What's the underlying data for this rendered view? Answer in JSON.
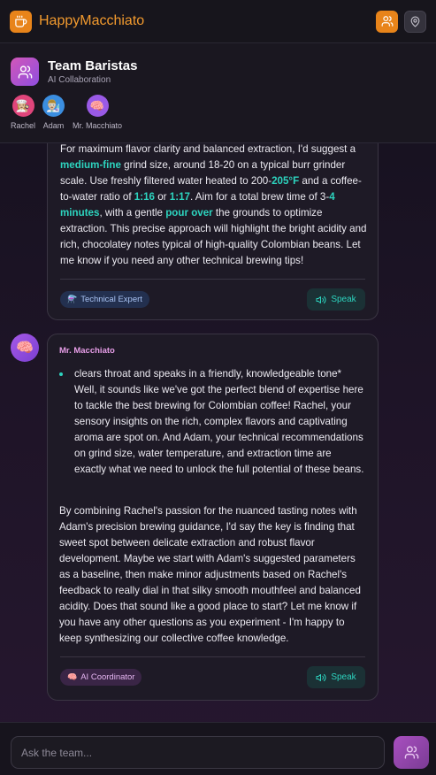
{
  "app": {
    "title": "HappyMacchiato"
  },
  "header": {
    "icons": {
      "logo": "coffee-icon",
      "users": "users-icon",
      "location": "map-pin-icon"
    },
    "colors": {
      "accent": "#e8841a"
    }
  },
  "team": {
    "title": "Team Baristas",
    "subtitle": "AI Collaboration",
    "members": [
      {
        "name": "Rachel",
        "emoji": "👩🏼‍🍳",
        "color": "#e0457b"
      },
      {
        "name": "Adam",
        "emoji": "👨🏼‍🔬",
        "color": "#3b8ee0"
      },
      {
        "name": "Mr. Macchiato",
        "emoji": "🧠",
        "color": "#9a5ae6"
      }
    ]
  },
  "messages": [
    {
      "segments": [
        "For maximum flavor clarity and balanced extraction, I'd suggest a ",
        "medium-fine",
        " grind size, around 18-20 on a typical burr grinder scale. Use freshly filtered water heated to 200-",
        "205°F",
        " and a coffee-to-water ratio of ",
        "1:16",
        " or ",
        "1:17",
        ". Aim for a total brew time of 3-",
        "4 minutes",
        ", with a gentle ",
        "pour over",
        " the grounds to optimize extraction. This precise approach will highlight the bright acidity and rich, chocolatey notes typical of high-quality Colombian beans. Let me know if you need any other technical brewing tips!"
      ],
      "tag": {
        "emoji": "⚗️",
        "label": "Technical Expert"
      },
      "speak_label": "Speak"
    },
    {
      "sender": "Mr. Macchiato",
      "avatar_emoji": "🧠",
      "bullet": "clears throat and speaks in a friendly, knowledgeable tone* Well, it sounds like we've got the perfect blend of expertise here to tackle the best brewing for Colombian coffee! Rachel, your sensory insights on the rich, complex flavors and captivating aroma are spot on. And Adam, your technical recommendations on grind size, water temperature, and extraction time are exactly what we need to unlock the full potential of these beans.",
      "paragraph": "By combining Rachel's passion for the nuanced tasting notes with Adam's precision brewing guidance, I'd say the key is finding that sweet spot between delicate extraction and robust flavor development. Maybe we start with Adam's suggested parameters as a baseline, then make minor adjustments based on Rachel's feedback to really dial in that silky smooth mouthfeel and balanced acidity. Does that sound like a good place to start? Let me know if you have any other questions as you experiment - I'm happy to keep synthesizing our collective coffee knowledge.",
      "tag": {
        "emoji": "🧠",
        "label": "AI Coordinator"
      },
      "speak_label": "Speak"
    }
  ],
  "composer": {
    "placeholder": "Ask the team...",
    "value": "",
    "send_icon": "users-icon"
  }
}
